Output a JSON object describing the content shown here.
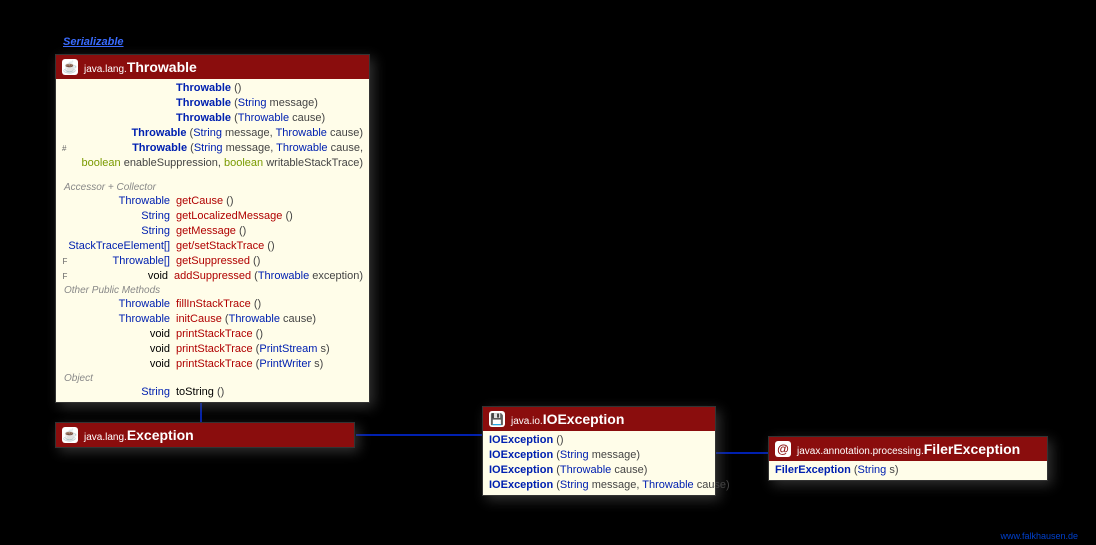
{
  "interface_label": "Serializable",
  "credit": "www.falkhausen.de",
  "classes": {
    "throwable": {
      "pkg": "java.lang.",
      "name": "Throwable",
      "ctors": [
        {
          "m": "",
          "name": "Throwable",
          "params": "()"
        },
        {
          "m": "",
          "name": "Throwable",
          "params": "(String message)"
        },
        {
          "m": "",
          "name": "Throwable",
          "params": "(Throwable cause)"
        },
        {
          "m": "",
          "name": "Throwable",
          "params": "(String message, Throwable cause)"
        },
        {
          "m": "#",
          "name": "Throwable",
          "params": "(String message, Throwable cause,"
        }
      ],
      "ctor_cont": "boolean enableSuppression, boolean writableStackTrace)",
      "sec1": "Accessor + Collector",
      "acc": [
        {
          "ret": "Throwable",
          "name": "getCause",
          "params": "()"
        },
        {
          "ret": "String",
          "name": "getLocalizedMessage",
          "params": "()"
        },
        {
          "ret": "String",
          "name": "getMessage",
          "params": "()"
        },
        {
          "ret": "StackTraceElement[]",
          "name": "get/setStackTrace",
          "params": "()"
        },
        {
          "m": "F",
          "ret": "Throwable[]",
          "name": "getSuppressed",
          "params": "()"
        },
        {
          "m": "F",
          "ret": "void",
          "name": "addSuppressed",
          "params": "(Throwable exception)"
        }
      ],
      "sec2": "Other Public Methods",
      "pub": [
        {
          "ret": "Throwable",
          "name": "fillInStackTrace",
          "params": "()"
        },
        {
          "ret": "Throwable",
          "name": "initCause",
          "params": "(Throwable cause)"
        },
        {
          "ret": "void",
          "name": "printStackTrace",
          "params": "()"
        },
        {
          "ret": "void",
          "name": "printStackTrace",
          "params": "(PrintStream s)"
        },
        {
          "ret": "void",
          "name": "printStackTrace",
          "params": "(PrintWriter s)"
        }
      ],
      "sec3": "Object",
      "obj": [
        {
          "ret": "String",
          "name": "toString",
          "params": "()"
        }
      ]
    },
    "exception": {
      "pkg": "java.lang.",
      "name": "Exception"
    },
    "ioexception": {
      "pkg": "java.io.",
      "name": "IOException",
      "ctors": [
        {
          "name": "IOException",
          "params": "()"
        },
        {
          "name": "IOException",
          "params": "(String message)"
        },
        {
          "name": "IOException",
          "params": "(Throwable cause)"
        },
        {
          "name": "IOException",
          "params": "(String message, Throwable cause)"
        }
      ]
    },
    "filer": {
      "pkg": "javax.annotation.processing.",
      "name": "FilerException",
      "ctors": [
        {
          "name": "FilerException",
          "params": "(String s)"
        }
      ]
    }
  }
}
